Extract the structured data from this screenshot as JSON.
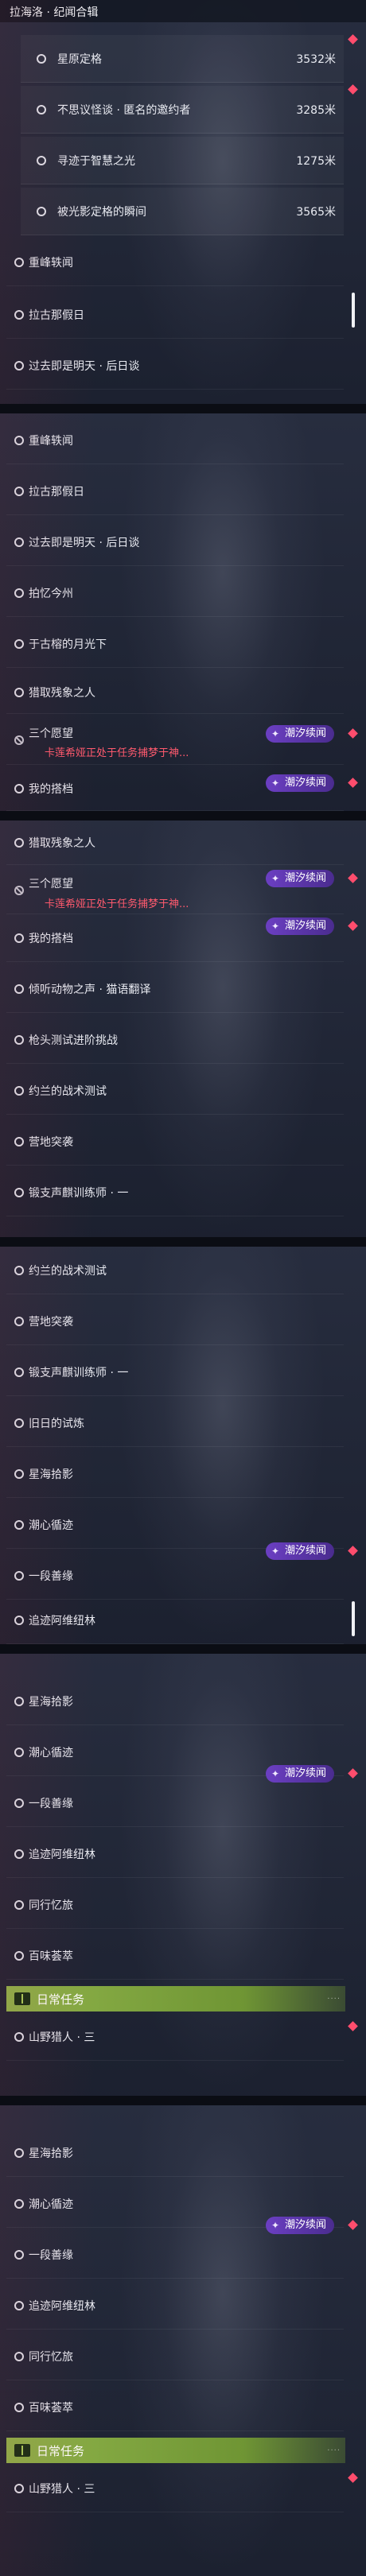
{
  "title": "拉海洛 · 纪闻合辑",
  "labels": {
    "tag": "潮汐续闻",
    "blocked_warning": "卡莲希娅正处于任务捕梦于神...",
    "section_daily": "日常任务"
  },
  "panels": [
    {
      "rows": [
        {
          "name": "星原定格",
          "distance": "3532米",
          "sub": true
        },
        {
          "name": "不思议怪谈 · 匿名的邀约者",
          "distance": "3285米",
          "sub": true
        },
        {
          "name": "寻迹于智慧之光",
          "distance": "1275米",
          "sub": true
        },
        {
          "name": "被光影定格的瞬间",
          "distance": "3565米",
          "sub": true
        },
        {
          "name": "重峰轶闻"
        },
        {
          "name": "拉古那假日"
        },
        {
          "name": "过去即是明天 · 后日谈"
        }
      ]
    },
    {
      "rows": [
        {
          "name": "重峰轶闻"
        },
        {
          "name": "拉古那假日"
        },
        {
          "name": "过去即是明天 · 后日谈"
        },
        {
          "name": "拍忆今州"
        },
        {
          "name": "于古榕的月光下"
        },
        {
          "name": "猎取残象之人"
        },
        {
          "name": "三个愿望",
          "blocked": true
        },
        {
          "name": "我的搭档"
        }
      ]
    },
    {
      "rows": [
        {
          "name": "猎取残象之人"
        },
        {
          "name": "三个愿望",
          "blocked": true
        },
        {
          "name": "我的搭档"
        },
        {
          "name": "倾听动物之声 · 猫语翻译"
        },
        {
          "name": "枪头测试进阶挑战"
        },
        {
          "name": "约兰的战术测试"
        },
        {
          "name": "营地突袭"
        },
        {
          "name": "锻支声麒训练师 · 一"
        }
      ]
    },
    {
      "rows": [
        {
          "name": "约兰的战术测试"
        },
        {
          "name": "营地突袭"
        },
        {
          "name": "锻支声麒训练师 · 一"
        },
        {
          "name": "旧日的试炼"
        },
        {
          "name": "星海拾影"
        },
        {
          "name": "潮心循迹"
        },
        {
          "name": "一段善缘"
        },
        {
          "name": "追迹阿维纽林"
        }
      ]
    },
    {
      "rows": [
        {
          "name": "星海拾影"
        },
        {
          "name": "潮心循迹"
        },
        {
          "name": "一段善缘"
        },
        {
          "name": "追迹阿维纽林"
        },
        {
          "name": "同行忆旅"
        },
        {
          "name": "百味荟萃"
        },
        {
          "name": "山野猎人 · 三"
        }
      ]
    },
    {
      "rows": [
        {
          "name": "星海拾影"
        },
        {
          "name": "潮心循迹"
        },
        {
          "name": "一段善缘"
        },
        {
          "name": "追迹阿维纽林"
        },
        {
          "name": "同行忆旅"
        },
        {
          "name": "百味荟萃"
        },
        {
          "name": "山野猎人 · 三"
        }
      ]
    }
  ]
}
